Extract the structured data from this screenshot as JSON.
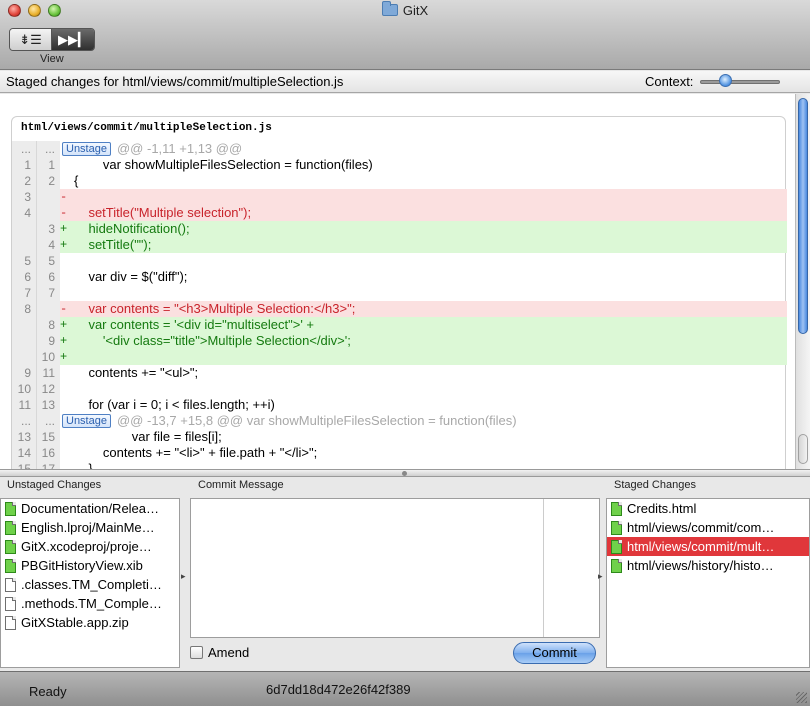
{
  "window": {
    "title": "GitX"
  },
  "toolbar": {
    "view_modes": [
      "⇟☰",
      "▶▶▎"
    ],
    "view_label": "View"
  },
  "header": {
    "title": "Staged changes for html/views/commit/multipleSelection.js",
    "context_label": "Context:",
    "context_value_fraction": 0.25
  },
  "diff": {
    "file": "html/views/commit/multipleSelection.js",
    "unstage_label": "Unstage",
    "rows": [
      {
        "type": "hunk",
        "old": "...",
        "new": "...",
        "text": "@@ -1,11 +1,13 @@"
      },
      {
        "type": "ctx",
        "old": "1",
        "new": "1",
        "mark": "",
        "text": "        var showMultipleFilesSelection = function(files)"
      },
      {
        "type": "ctx",
        "old": "2",
        "new": "2",
        "mark": "",
        "text": "{"
      },
      {
        "type": "del",
        "old": "3",
        "new": "",
        "mark": "-",
        "text": ""
      },
      {
        "type": "del",
        "old": "4",
        "new": "",
        "mark": "-",
        "text": "    setTitle(\"Multiple selection\");"
      },
      {
        "type": "add",
        "old": "",
        "new": "3",
        "mark": "+",
        "text": "    hideNotification();"
      },
      {
        "type": "add",
        "old": "",
        "new": "4",
        "mark": "+",
        "text": "    setTitle(\"\");"
      },
      {
        "type": "ctx",
        "old": "5",
        "new": "5",
        "mark": "",
        "text": ""
      },
      {
        "type": "ctx",
        "old": "6",
        "new": "6",
        "mark": "",
        "text": "    var div = $(\"diff\");"
      },
      {
        "type": "ctx",
        "old": "7",
        "new": "7",
        "mark": "",
        "text": ""
      },
      {
        "type": "del",
        "old": "8",
        "new": "",
        "mark": "-",
        "text": "    var contents = \"<h3>Multiple Selection:</h3>\";"
      },
      {
        "type": "add",
        "old": "",
        "new": "8",
        "mark": "+",
        "text": "    var contents = '<div id=\"multiselect\">' +"
      },
      {
        "type": "add",
        "old": "",
        "new": "9",
        "mark": "+",
        "text": "        '<div class=\"title\">Multiple Selection</div>';"
      },
      {
        "type": "add",
        "old": "",
        "new": "10",
        "mark": "+",
        "text": ""
      },
      {
        "type": "ctx",
        "old": "9",
        "new": "11",
        "mark": "",
        "text": "    contents += \"<ul>\";"
      },
      {
        "type": "ctx",
        "old": "10",
        "new": "12",
        "mark": "",
        "text": ""
      },
      {
        "type": "ctx",
        "old": "11",
        "new": "13",
        "mark": "",
        "text": "    for (var i = 0; i < files.length; ++i)"
      },
      {
        "type": "hunk",
        "old": "...",
        "new": "...",
        "text": "@@ -13,7 +15,8 @@ var showMultipleFilesSelection = function(files)"
      },
      {
        "type": "ctx",
        "old": "13",
        "new": "15",
        "mark": "",
        "text": "                var file = files[i];"
      },
      {
        "type": "ctx",
        "old": "14",
        "new": "16",
        "mark": "",
        "text": "        contents += \"<li>\" + file.path + \"</li>\";"
      },
      {
        "type": "ctx",
        "old": "15",
        "new": "17",
        "mark": "",
        "text": "    }"
      }
    ]
  },
  "unstaged": {
    "heading": "Unstaged Changes",
    "items": [
      {
        "name": "Documentation/Relea…",
        "modified": true
      },
      {
        "name": "English.lproj/MainMe…",
        "modified": true
      },
      {
        "name": "GitX.xcodeproj/proje…",
        "modified": true
      },
      {
        "name": "PBGitHistoryView.xib",
        "modified": true
      },
      {
        "name": ".classes.TM_Completi…",
        "modified": false
      },
      {
        "name": ".methods.TM_Comple…",
        "modified": false
      },
      {
        "name": "GitXStable.app.zip",
        "modified": false
      }
    ]
  },
  "commit": {
    "heading": "Commit Message",
    "message": "",
    "amend_label": "Amend",
    "button_label": "Commit"
  },
  "staged": {
    "heading": "Staged Changes",
    "items": [
      {
        "name": "Credits.html",
        "selected": false
      },
      {
        "name": "html/views/commit/com…",
        "selected": false
      },
      {
        "name": "html/views/commit/mult…",
        "selected": true
      },
      {
        "name": "html/views/history/histo…",
        "selected": false
      }
    ]
  },
  "status": {
    "text": "Ready",
    "hash": "6d7dd18d472e26f42f389"
  }
}
